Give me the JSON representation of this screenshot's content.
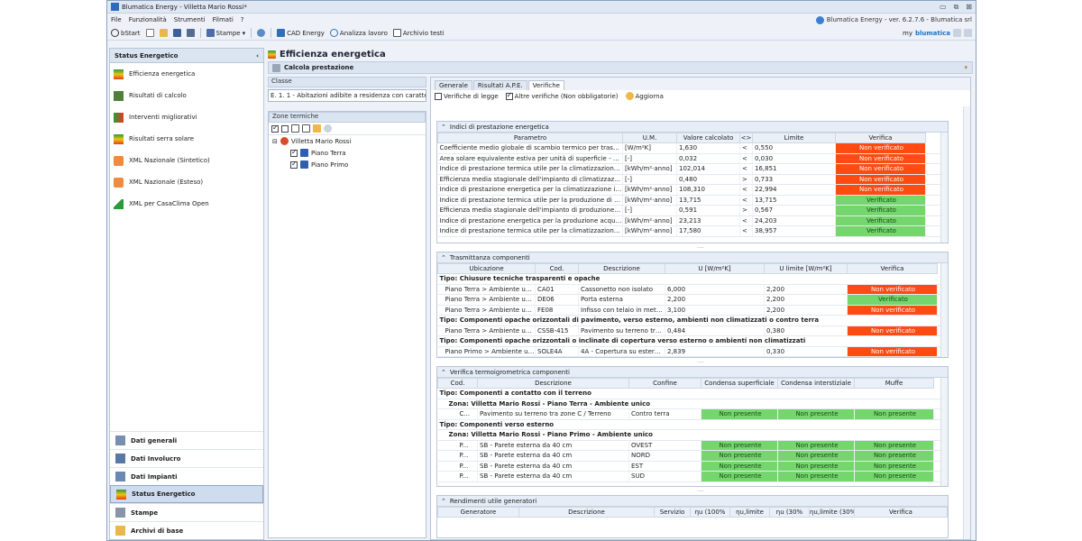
{
  "window": {
    "title": "Blumatica Energy - Villetta Mario Rossi*",
    "version_text": "Blumatica Energy - ver. 6.2.7.6 - Blumatica srl"
  },
  "menu": [
    "File",
    "Funzionalità",
    "Strumenti",
    "Filmati",
    "?"
  ],
  "toolbar": {
    "bstart": "bStart",
    "stampe": "Stampe",
    "cad": "CAD Energy",
    "analizza": "Analizza lavoro",
    "archivio": "Archivio testi",
    "my": "my",
    "brand": "blumatica"
  },
  "left": {
    "header": "Status Energetico",
    "items": [
      "Efficienza energetica",
      "Risultati di calcolo",
      "Interventi migliorativi",
      "Risultati serra solare",
      "XML Nazionale (Sintetico)",
      "XML Nazionale (Esteso)",
      "XML per CasaClima Open"
    ],
    "nav": [
      "Dati generali",
      "Dati Involucro",
      "Dati Impianti",
      "Status Energetico",
      "Stampe",
      "Archivi di base"
    ]
  },
  "page": {
    "title": "Efficienza energetica",
    "subtitle": "Calcola prestazione"
  },
  "classe": {
    "label": "Classe",
    "value": "E. 1. 1 - Abitazioni adibite a residenza con carattere ..."
  },
  "zone": {
    "label": "Zone termiche",
    "root": "Villetta Mario Rossi",
    "children": [
      "Piano Terra",
      "Piano Primo"
    ]
  },
  "tabs": [
    "Generale",
    "Risultati A.P.E.",
    "Verifiche"
  ],
  "verbar": {
    "legge": "Verifiche di legge",
    "altre": "Altre verifiche (Non obbligatorie)",
    "aggiorna": "Aggiorna"
  },
  "indici": {
    "title": "Indici di prestazione energetica",
    "headers": [
      "Parametro",
      "U.M.",
      "Valore calcolato",
      "<>",
      "Limite",
      "Verifica"
    ],
    "rows": [
      [
        "Coefficiente medio globale di scambio termico per trasmissione p...",
        "[W/m²K]",
        "1,630",
        "<",
        "0,550",
        "Non verificato"
      ],
      [
        "Area solare equivalente estiva per unità di superficie - Asol,est/...",
        "[-]",
        "0,032",
        "<",
        "0,030",
        "Non verificato"
      ],
      [
        "Indice di prestazione termica utile per la climatizzazione invernale...",
        "[kWh/m²·anno]",
        "102,014",
        "<",
        "16,851",
        "Non verificato"
      ],
      [
        "Efficienza media stagionale dell'impianto di climatizzazione invern...",
        "[-]",
        "0,480",
        ">",
        "0,733",
        "Non verificato"
      ],
      [
        "Indice di prestazione energetica per la climatizzazione invernale -...",
        "[kWh/m²·anno]",
        "108,310",
        "<",
        "22,994",
        "Non verificato"
      ],
      [
        "Indice di prestazione termica utile per la produzione di acqua cald...",
        "[kWh/m²·anno]",
        "13,715",
        "<",
        "13,715",
        "Verificato"
      ],
      [
        "Efficienza media stagionale dell'impianto di produzione acqua cald...",
        "[-]",
        "0,591",
        ">",
        "0,567",
        "Verificato"
      ],
      [
        "Indice di prestazione energetica per la produzione acqua calda s...",
        "[kWh/m²·anno]",
        "23,213",
        "<",
        "24,203",
        "Verificato"
      ],
      [
        "Indice di prestazione termica utile per la climatizzazione estiva - E...",
        "[kWh/m²·anno]",
        "17,580",
        "<",
        "38,957",
        "Verificato"
      ]
    ]
  },
  "trasm": {
    "title": "Trasmittanza componenti",
    "headers": [
      "Ubicazione",
      "Cod.",
      "Descrizione",
      "U [W/m²K]",
      "U limite [W/m²K]",
      "Verifica"
    ],
    "rows": [
      {
        "g": "Tipo: Chiusure tecniche trasparenti e opache"
      },
      {
        "r": [
          "Piano Terra > Ambiente unico > ...",
          "CA01",
          "Cassonetto non isolato",
          "6,000",
          "2,200",
          "Non verificato"
        ]
      },
      {
        "r": [
          "Piano Terra > Ambiente unico > ...",
          "DE06",
          "Porta esterna",
          "2,200",
          "2,200",
          "Verificato"
        ]
      },
      {
        "r": [
          "Piano Terra > Ambiente unico > ...",
          "FE08",
          "Infisso con telaio in metallo...",
          "3,100",
          "2,200",
          "Non verificato"
        ]
      },
      {
        "g": "Tipo: Componenti opache orizzontali di pavimento, verso esterno, ambienti non climatizzati o contro terra"
      },
      {
        "r": [
          "Piano Terra > Ambiente unico > ...",
          "CSSB-415",
          "Pavimento su terreno tra z...",
          "0,484",
          "0,380",
          "Non verificato"
        ]
      },
      {
        "g": "Tipo: Componenti opache orizzontali o inclinate di copertura verso esterno o ambienti non climatizzati"
      },
      {
        "r": [
          "Piano Primo > Ambiente unico...",
          "SOLE4A",
          "4A - Copertura su esterno ...",
          "2,839",
          "0,330",
          "Non verificato"
        ]
      },
      {
        "g": "Tipo: Componenti opachi verticali verso esterno, ambienti non climatizzati o contro terra"
      }
    ]
  },
  "termo": {
    "title": "Verifica termoigrometrica componenti",
    "headers": [
      "Cod.",
      "Descrizione",
      "Confine",
      "Condensa superficiale",
      "Condensa interstiziale",
      "Muffe"
    ],
    "rows": [
      {
        "g": "Tipo: Componenti a contatto con il terreno"
      },
      {
        "z": "Zona: Villetta Mario Rossi - Piano Terra - Ambiente unico"
      },
      {
        "r": [
          "C...",
          "Pavimento su terreno tra zone C / Terreno",
          "Contro terra",
          "Non presente",
          "Non presente",
          "Non presente"
        ]
      },
      {
        "g": "Tipo: Componenti verso esterno"
      },
      {
        "z": "Zona: Villetta Mario Rossi - Piano Primo - Ambiente unico"
      },
      {
        "r": [
          "P...",
          "SB - Parete esterna da 40 cm",
          "OVEST",
          "Non presente",
          "Non presente",
          "Non presente"
        ]
      },
      {
        "r": [
          "P...",
          "SB - Parete esterna da 40 cm",
          "NORD",
          "Non presente",
          "Non presente",
          "Non presente"
        ]
      },
      {
        "r": [
          "P...",
          "SB - Parete esterna da 40 cm",
          "EST",
          "Non presente",
          "Non presente",
          "Non presente"
        ]
      },
      {
        "r": [
          "P...",
          "SB - Parete esterna da 40 cm",
          "SUD",
          "Non presente",
          "Non presente",
          "Non presente"
        ]
      }
    ]
  },
  "rend": {
    "title": "Rendimenti utile generatori",
    "headers": [
      "Generatore",
      "Descrizione",
      "Servizio",
      "ηu (100%",
      "ηu,limite",
      "ηu (30%",
      "ηu,limite (30% Pn)",
      "Verifica"
    ]
  }
}
